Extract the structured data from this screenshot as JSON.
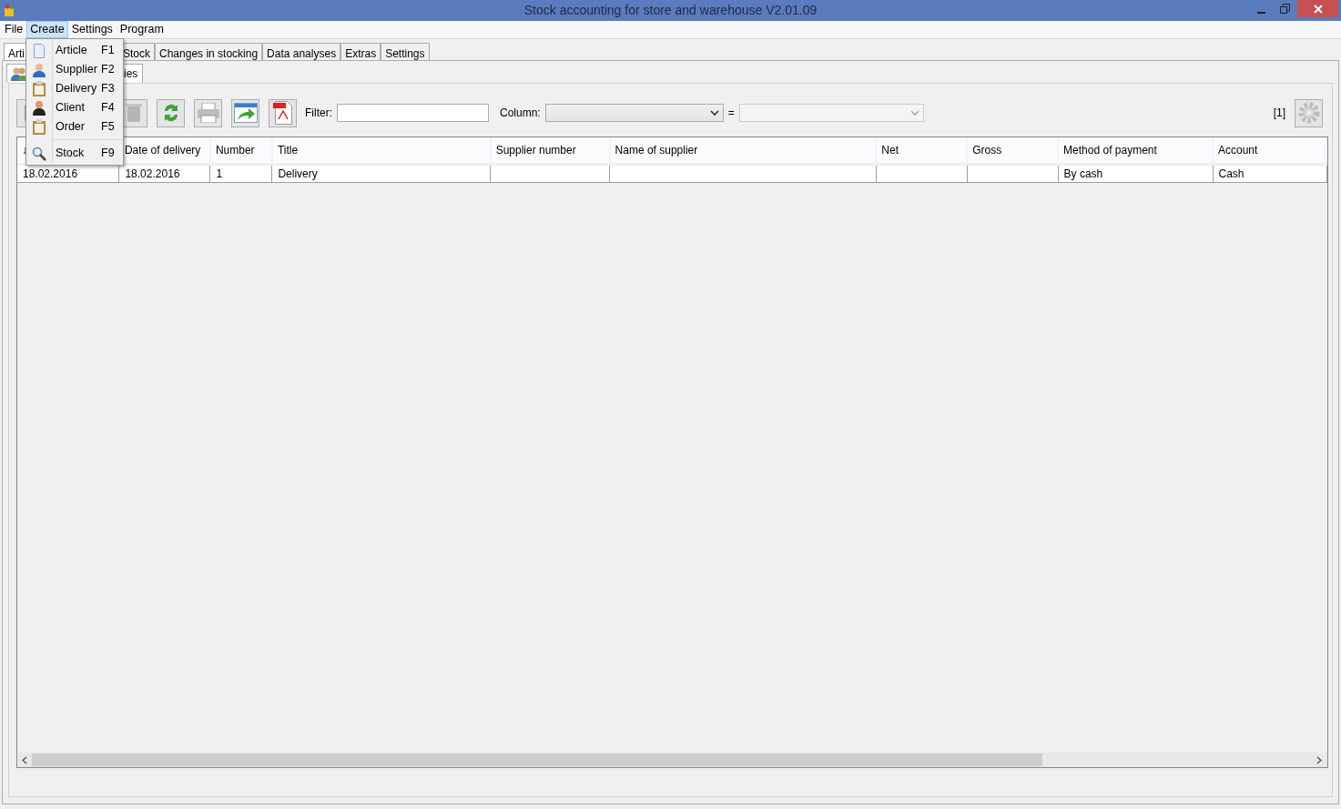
{
  "window": {
    "title": "Stock accounting for store and warehouse V2.01.09"
  },
  "menu": [
    {
      "label": "File",
      "selected": false
    },
    {
      "label": "Create",
      "selected": true
    },
    {
      "label": "Settings",
      "selected": false
    },
    {
      "label": "Program",
      "selected": false
    }
  ],
  "dropdown": [
    {
      "label": "Article",
      "shortcut": "F1",
      "kind": "page"
    },
    {
      "label": "Supplier",
      "shortcut": "F2",
      "kind": "person"
    },
    {
      "label": "Delivery",
      "shortcut": "F3",
      "kind": "clipboard"
    },
    {
      "label": "Client",
      "shortcut": "F4",
      "kind": "client"
    },
    {
      "label": "Order",
      "shortcut": "F5",
      "kind": "clipboard"
    },
    {
      "label": "Stock",
      "shortcut": "F9",
      "kind": "search",
      "separator_before": true
    }
  ],
  "tabs": [
    {
      "label": "Arti",
      "selected": true
    },
    {
      "label": "Stock",
      "selected": false
    },
    {
      "label": "Changes in stocking",
      "selected": false
    },
    {
      "label": "Data analyses",
      "selected": false
    },
    {
      "label": "Extras",
      "selected": false
    },
    {
      "label": "Settings",
      "selected": false
    }
  ],
  "subtab": {
    "label": "ies"
  },
  "toolbar": {
    "filter_label": "Filter:",
    "column_label": "Column:",
    "equals": "=",
    "count": "[1]"
  },
  "table": {
    "columns": [
      "↓",
      "Date of delivery",
      "Number",
      "Title",
      "Supplier number",
      "Name of supplier",
      "Net",
      "Gross",
      "Method of payment",
      "Account"
    ],
    "rows": [
      [
        "18.02.2016",
        "18.02.2016",
        "1",
        "Delivery",
        "",
        "",
        "",
        "",
        "By cash",
        "Cash"
      ]
    ]
  }
}
